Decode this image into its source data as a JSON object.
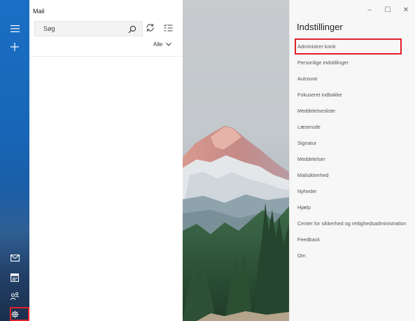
{
  "app": {
    "title": "Mail"
  },
  "rail": {
    "icons": [
      "hamburger-menu-icon",
      "new-mail-icon",
      "mail-icon",
      "calendar-icon",
      "people-icon",
      "settings-icon"
    ]
  },
  "search": {
    "placeholder": "Søg"
  },
  "filter": {
    "label": "Alle"
  },
  "window_controls": {
    "minimize": "–",
    "maximize": "☐",
    "close": "✕"
  },
  "settings": {
    "title": "Indstillinger",
    "items": [
      "Administrer konti",
      "Personlige indstillinger",
      "Autosvar",
      "Fokuseret indbakke",
      "Meddelelsesliste",
      "Læserude",
      "Signatur",
      "Meddelelser",
      "Mailsikkerhed",
      "Nyheder",
      "Hjælp",
      "Center for sikkerhed og rettighedsadministration",
      "Feedback",
      "Om"
    ],
    "highlighted_item": "Administrer konti"
  },
  "colors": {
    "accent": "#1a6fc4",
    "highlight": "#e2202a"
  }
}
